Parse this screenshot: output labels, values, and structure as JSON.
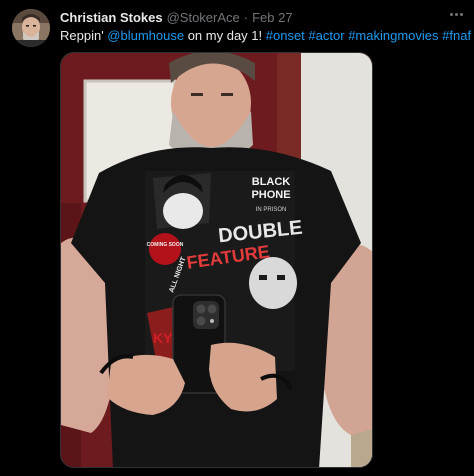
{
  "tweet": {
    "display_name": "Christian Stokes",
    "handle": "@StokerAce",
    "separator": "·",
    "date": "Feb 27",
    "text": {
      "prefix": "Reppin' ",
      "mention": "@blumhouse",
      "middle": " on my day 1! ",
      "hashtags": [
        "#onset",
        "#actor",
        "#makingmovies",
        "#fnaf"
      ]
    }
  },
  "shirt": {
    "blackphone_line1": "BLACK",
    "blackphone_line2": "PHONE",
    "in_prison": "IN PRISON",
    "double_feature_1": "DOUBLE",
    "double_feature_2": "FEATURE",
    "badge": "COMING SOON",
    "side_text": "ALL NIGHT",
    "bottom_text": "KY"
  },
  "colors": {
    "background": "#000000",
    "link": "#1d9bf0",
    "muted": "#71767b",
    "text": "#e7e9ea"
  },
  "icons": {
    "more": "more-horizontal-icon"
  }
}
